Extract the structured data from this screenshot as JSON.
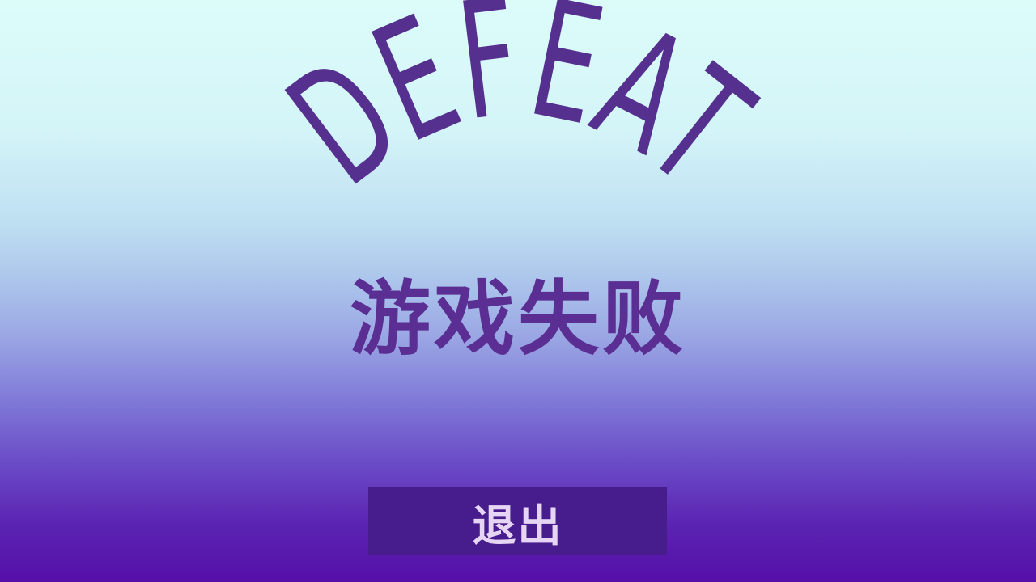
{
  "screen": {
    "title": "DEFEAT",
    "subtitle": "游戏失败",
    "exit_button_label": "退出"
  },
  "colors": {
    "title": "#56308f",
    "subtitle": "#5a2e92",
    "button_bg": "#471d8d",
    "button_text": "#e6d6f4",
    "background_top": "#dcfcfa",
    "background_bottom": "#550fa8"
  }
}
